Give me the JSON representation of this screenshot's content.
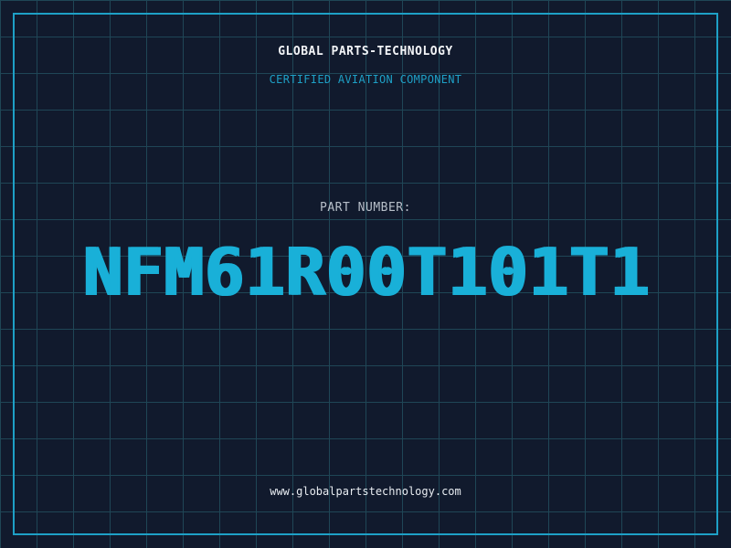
{
  "header": {
    "brand": "GLOBAL PARTS-TECHNOLOGY",
    "subtitle": "CERTIFIED AVIATION COMPONENT"
  },
  "part": {
    "label": "PART NUMBER:",
    "number": "NFM61R00T101T1"
  },
  "footer": {
    "url": "www.globalpartstechnology.com"
  },
  "colors": {
    "background": "#111a2d",
    "grid": "#1f4656",
    "accent": "#1ea0c6",
    "text": "#f2f4f7"
  }
}
